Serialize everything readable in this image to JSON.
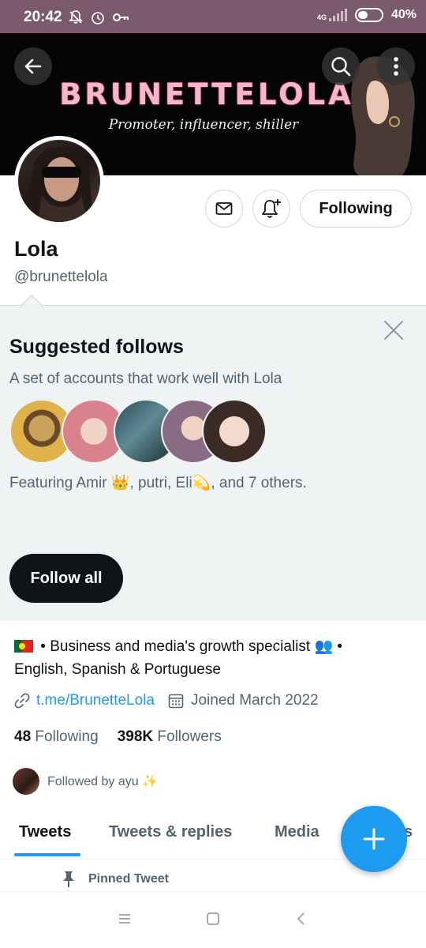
{
  "status_bar": {
    "time": "20:42",
    "network": "4G",
    "battery": "40%"
  },
  "banner": {
    "title": "BRUNETTELOLA",
    "subtitle": "Promoter, influencer, shiller"
  },
  "header": {
    "back_icon": "arrow-left-icon",
    "search_icon": "search-icon",
    "more_icon": "more-vertical-icon"
  },
  "profile": {
    "name": "Lola",
    "handle": "@brunettelola",
    "following_button": "Following",
    "bio_line1": "• Business and media's growth specialist 👥 •",
    "bio_line2": "English, Spanish & Portuguese",
    "link": "t.me/BrunetteLola",
    "joined": "Joined March 2022",
    "following_count": "48",
    "following_label": "Following",
    "followers_count": "398K",
    "followers_label": "Followers",
    "followed_by": "Followed by ayu ✨"
  },
  "suggested": {
    "title": "Suggested follows",
    "description": "A set of accounts that work well with Lola",
    "featuring": "Featuring Amir 👑, putri, Eli💫, and 7 others.",
    "follow_all": "Follow all"
  },
  "tabs": [
    {
      "label": "Tweets"
    },
    {
      "label": "Tweets & replies"
    },
    {
      "label": "Media"
    },
    {
      "label": "s"
    }
  ],
  "pinned": "Pinned Tweet",
  "colors": {
    "accent": "#1d9bf0",
    "status_bar": "#7a5a6c",
    "suggest_bg": "#eff3f4"
  }
}
